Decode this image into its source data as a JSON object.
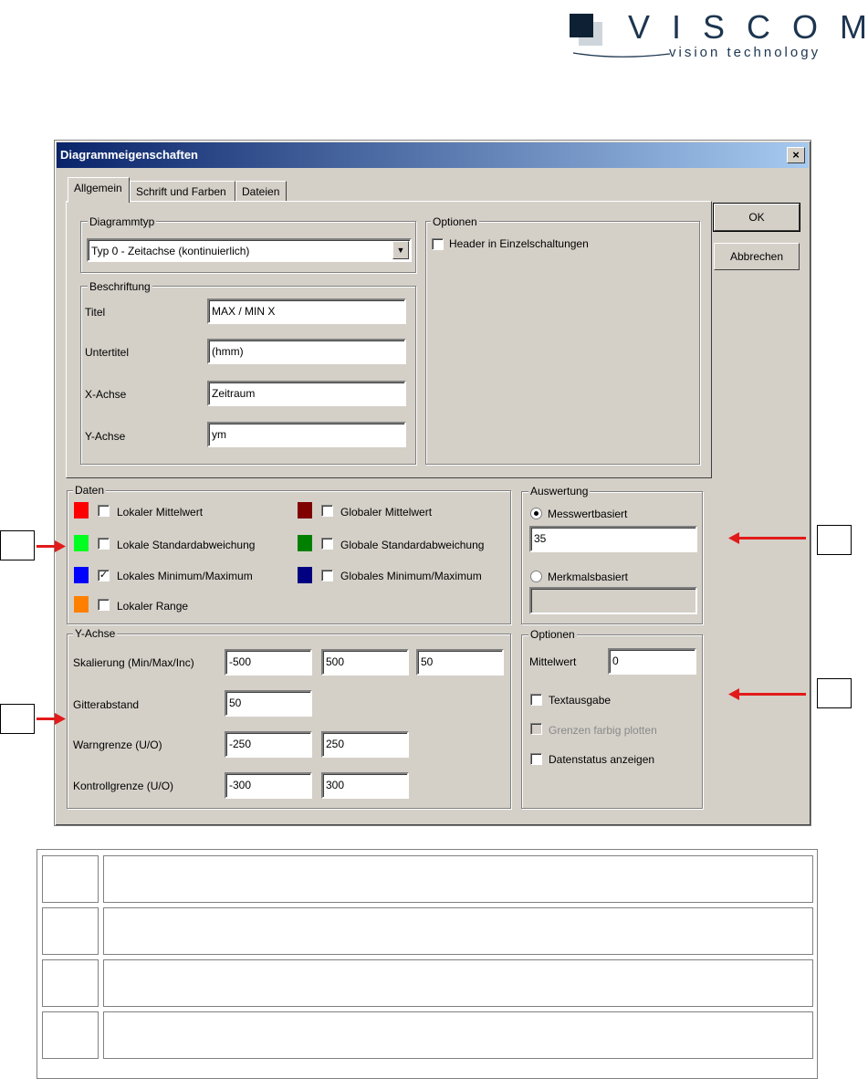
{
  "logo": {
    "name": "VISCOM",
    "tagline": "vision technology"
  },
  "dialog": {
    "title": "Diagrammeigenschaften",
    "close_label": "×",
    "tabs": [
      "Allgemein",
      "Schrift und Farben",
      "Dateien"
    ],
    "buttons": {
      "ok": "OK",
      "cancel": "Abbrechen"
    },
    "diagramtype": {
      "legend": "Diagrammtyp",
      "selected": "Typ 0 - Zeitachse (kontinuierlich)"
    },
    "options_top": {
      "legend": "Optionen",
      "header_single": "Header in Einzelschaltungen",
      "header_single_checked": false
    },
    "labeling": {
      "legend": "Beschriftung",
      "fields": [
        {
          "label": "Titel",
          "value": "MAX / MIN  X"
        },
        {
          "label": "Untertitel",
          "value": "(hmm)"
        },
        {
          "label": "X-Achse",
          "value": "Zeitraum"
        },
        {
          "label": "Y-Achse",
          "value": "ym"
        }
      ]
    },
    "data": {
      "legend": "Daten",
      "items": [
        {
          "label": "Lokaler Mittelwert",
          "color": "#ff0000",
          "checked": false
        },
        {
          "label": "Lokale Standardabweichung",
          "color": "#00ff20",
          "checked": false
        },
        {
          "label": "Lokales Minimum/Maximum",
          "color": "#0000ff",
          "checked": true
        },
        {
          "label": "Lokaler Range",
          "color": "#ff8000",
          "checked": false
        },
        {
          "label": "Globaler Mittelwert",
          "color": "#800000",
          "checked": false
        },
        {
          "label": "Globale Standardabweichung",
          "color": "#008000",
          "checked": false
        },
        {
          "label": "Globales Minimum/Maximum",
          "color": "#000080",
          "checked": false
        }
      ]
    },
    "evaluation": {
      "legend": "Auswertung",
      "measured_label": "Messwertbasiert",
      "measured_selected": true,
      "measured_value": "35",
      "feature_label": "Merkmalsbasiert",
      "feature_selected": false,
      "feature_value": ""
    },
    "yaxis": {
      "legend": "Y-Achse",
      "scaling_label": "Skalierung (Min/Max/Inc)",
      "scaling": [
        "-500",
        "500",
        "50"
      ],
      "grid_label": "Gitterabstand",
      "grid": "50",
      "warning_label": "Warngrenze (U/O)",
      "warning": [
        "-250",
        "250"
      ],
      "control_label": "Kontrollgrenze (U/O)",
      "control": [
        "-300",
        "300"
      ]
    },
    "options_bottom": {
      "legend": "Optionen",
      "mean_label": "Mittelwert",
      "mean_value": "0",
      "text_output": "Textausgabe",
      "text_output_checked": false,
      "colored_limits": "Grenzen farbig plotten",
      "colored_limits_checked": false,
      "data_status": "Datenstatus anzeigen",
      "data_status_checked": false
    }
  },
  "annotation_arrow_color": "#e21a1a"
}
